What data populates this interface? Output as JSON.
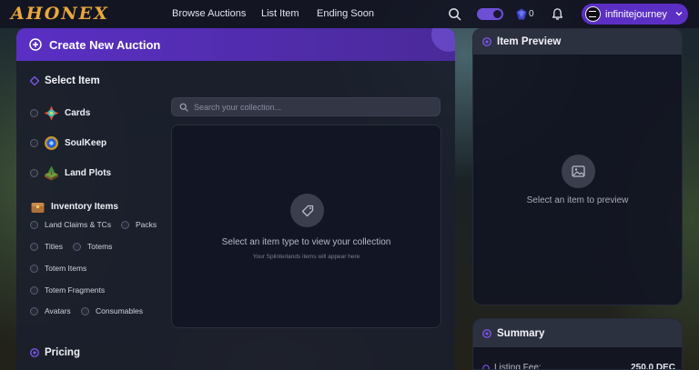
{
  "topbar": {
    "logo": "AHONEX",
    "nav": {
      "browse": "Browse Auctions",
      "list": "List Item",
      "ending": "Ending Soon"
    },
    "gem_count": "0",
    "username": "infinitejourney"
  },
  "main": {
    "title": "Create New Auction",
    "select_item_title": "Select Item",
    "item_types": {
      "cards": "Cards",
      "soulkeep": "SoulKeep",
      "land": "Land Plots"
    },
    "inventory_title": "Inventory Items",
    "inventory": {
      "land_claims": "Land Claims & TCs",
      "packs": "Packs",
      "titles": "Titles",
      "totems": "Totems",
      "totem_items": "Totem Items",
      "totem_fragments": "Totem Fragments",
      "avatars": "Avatars",
      "consumables": "Consumables"
    },
    "search_placeholder": "Search your collection...",
    "collection_message": "Select an item type to view your collection",
    "collection_sub": "Your Splinterlands items will appear here",
    "pricing_title": "Pricing"
  },
  "preview": {
    "title": "Item Preview",
    "message": "Select an item to preview"
  },
  "summary": {
    "title": "Summary",
    "fee_label": "Listing Fee:",
    "fee_value": "250.0 DEC"
  },
  "colors": {
    "accent": "#5b2fc4",
    "logo": "#e9a93a",
    "toggle": "#6d4fd6"
  }
}
